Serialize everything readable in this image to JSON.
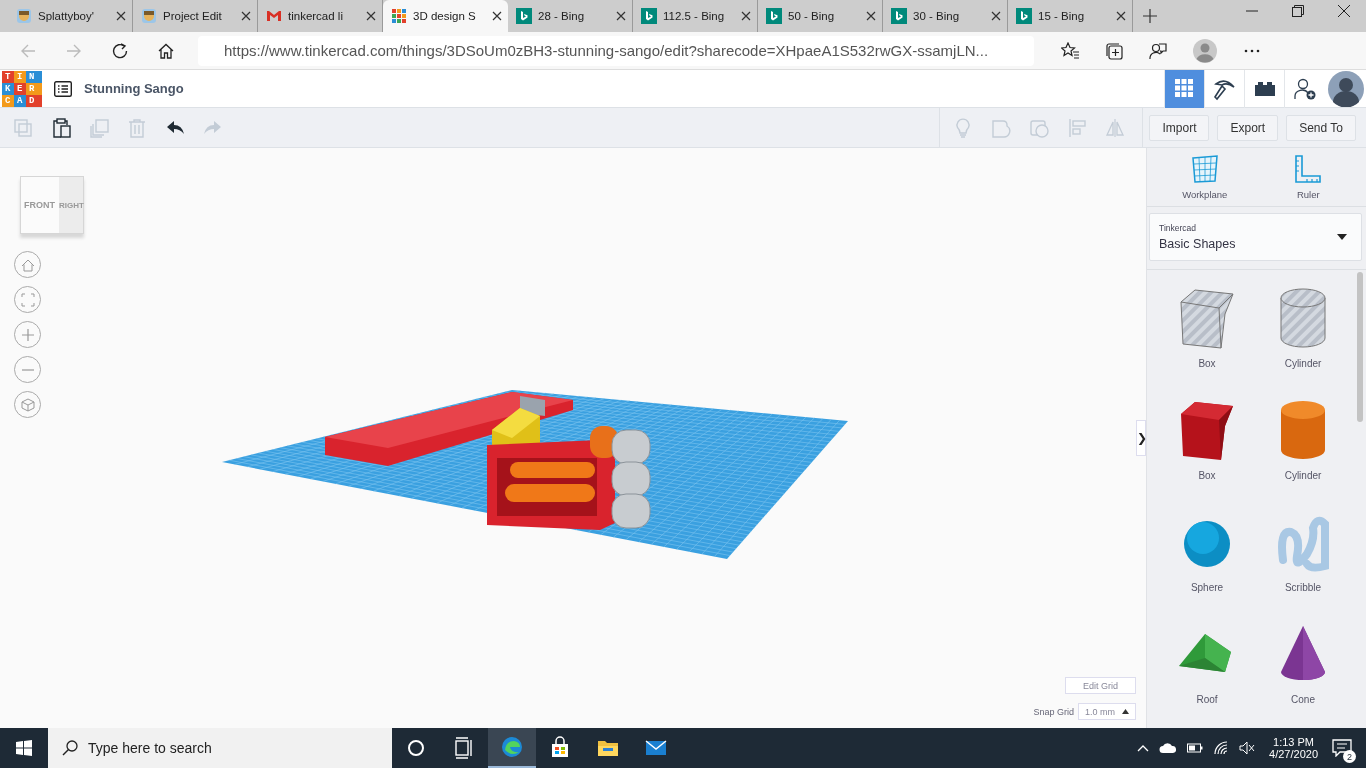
{
  "browser": {
    "tabs": [
      {
        "title": "Splattyboy'",
        "kind": "avatar",
        "selected": false
      },
      {
        "title": "Project Edit",
        "kind": "avatar",
        "selected": false
      },
      {
        "title": "tinkercad li",
        "kind": "mail",
        "selected": false
      },
      {
        "title": "3D design S",
        "kind": "tinkercad",
        "selected": true
      },
      {
        "title": "28 - Bing",
        "kind": "bing",
        "selected": false
      },
      {
        "title": "112.5 - Bing",
        "kind": "bing",
        "selected": false
      },
      {
        "title": "50 - Bing",
        "kind": "bing",
        "selected": false
      },
      {
        "title": "30 - Bing",
        "kind": "bing",
        "selected": false
      },
      {
        "title": "15 - Bing",
        "kind": "bing",
        "selected": false
      }
    ],
    "url": "https://www.tinkercad.com/things/3DSoUm0zBH3-stunning-sango/edit?sharecode=XHpaeA1S532rwGX-ssamjLN..."
  },
  "app": {
    "logo": [
      "TIN",
      "KER",
      "CAD"
    ],
    "design_title": "Stunning Sango",
    "view_buttons": [
      {
        "kind": "grid",
        "selected": true
      },
      {
        "kind": "pickaxe",
        "selected": false
      },
      {
        "kind": "bricks",
        "selected": false
      },
      {
        "kind": "add-user",
        "selected": false
      }
    ],
    "toolbar": {
      "left": [
        {
          "kind": "copy",
          "disabled": true
        },
        {
          "kind": "paste",
          "disabled": false
        },
        {
          "kind": "duplicate",
          "disabled": true
        },
        {
          "kind": "delete",
          "disabled": true
        },
        {
          "kind": "undo",
          "disabled": false
        },
        {
          "kind": "redo",
          "disabled": true
        }
      ],
      "right": [
        {
          "kind": "bulb",
          "disabled": true
        },
        {
          "kind": "solid",
          "disabled": true
        },
        {
          "kind": "hole",
          "disabled": true
        },
        {
          "kind": "align",
          "disabled": true
        },
        {
          "kind": "mirror",
          "disabled": true
        }
      ],
      "buttons": [
        "Import",
        "Export",
        "Send To"
      ]
    },
    "canvas": {
      "view_cube": {
        "front": "FRONT",
        "right": "RIGHT"
      },
      "nav": [
        {
          "kind": "home"
        },
        {
          "kind": "fit"
        },
        {
          "kind": "zoom-in"
        },
        {
          "kind": "zoom-out"
        },
        {
          "kind": "perspective"
        }
      ],
      "edit_grid": "Edit Grid",
      "snap_grid": {
        "label": "Snap Grid",
        "value": "1.0 mm"
      },
      "panel_toggle": "❯"
    },
    "sidebar": {
      "tools": [
        {
          "label": "Workplane",
          "kind": "workplane"
        },
        {
          "label": "Ruler",
          "kind": "ruler"
        }
      ],
      "library": {
        "source": "Tinkercad",
        "value": "Basic Shapes"
      },
      "shapes": [
        {
          "label": "Box",
          "kind": "box-hole"
        },
        {
          "label": "Cylinder",
          "kind": "cylinder-hole"
        },
        {
          "label": "Box",
          "kind": "box"
        },
        {
          "label": "Cylinder",
          "kind": "cylinder"
        },
        {
          "label": "Sphere",
          "kind": "sphere"
        },
        {
          "label": "Scribble",
          "kind": "scribble"
        },
        {
          "label": "Roof",
          "kind": "roof"
        },
        {
          "label": "Cone",
          "kind": "cone"
        }
      ]
    }
  },
  "taskbar": {
    "search_placeholder": "Type here to search",
    "apps": [
      {
        "kind": "cortana",
        "active": false
      },
      {
        "kind": "task-view",
        "active": false
      },
      {
        "kind": "edge",
        "active": true
      },
      {
        "kind": "store",
        "active": false
      },
      {
        "kind": "explorer",
        "active": false
      },
      {
        "kind": "mail",
        "active": false
      }
    ],
    "time": "1:13 PM",
    "date": "4/27/2020",
    "notifications": "2"
  }
}
